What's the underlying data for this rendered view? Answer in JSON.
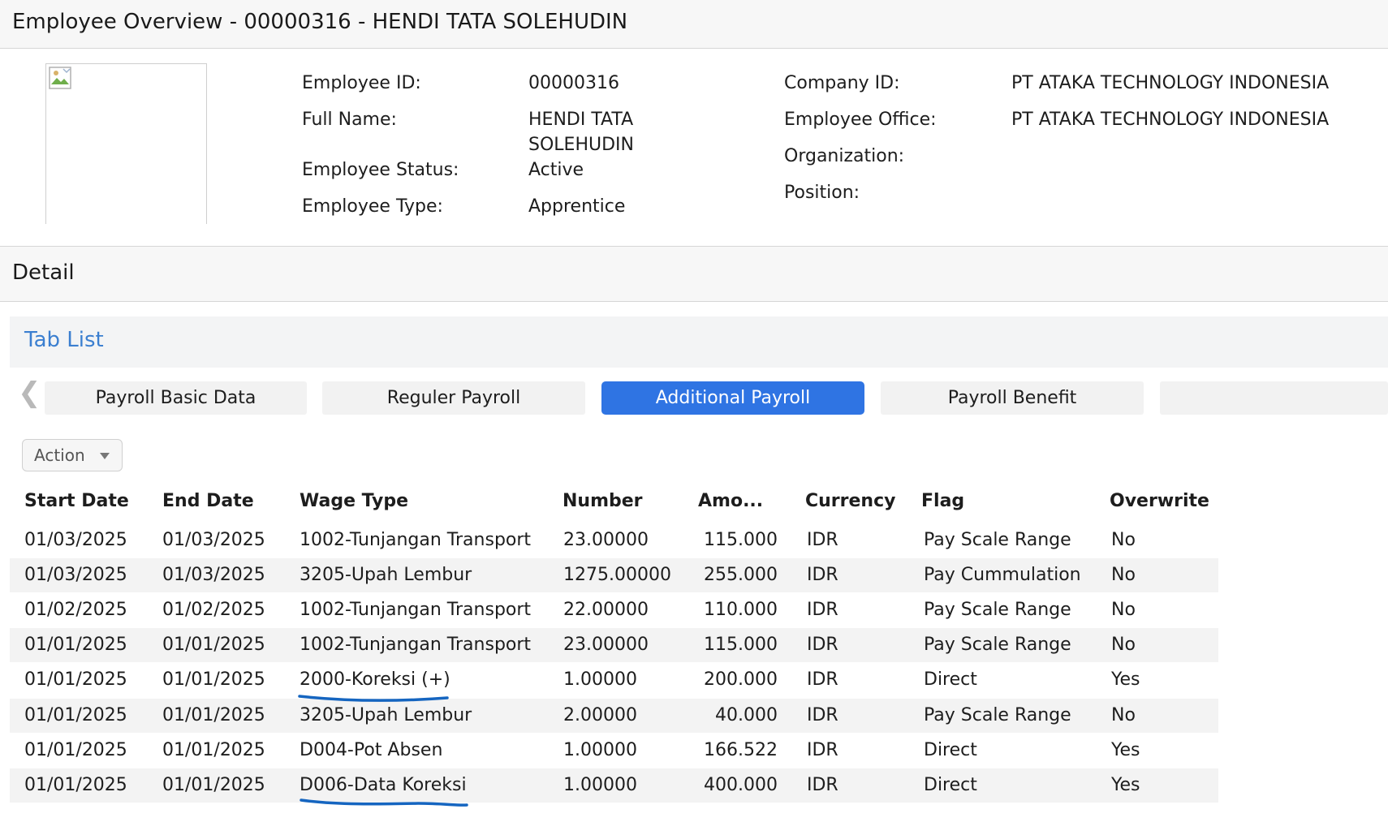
{
  "title": "Employee Overview - 00000316 - HENDI TATA SOLEHUDIN",
  "employee": {
    "labels": {
      "employee_id": "Employee ID:",
      "full_name": "Full Name:",
      "employee_status": "Employee Status:",
      "employee_type": "Employee Type:",
      "company_id": "Company ID:",
      "employee_office": "Employee Office:",
      "organization": "Organization:",
      "position": "Position:"
    },
    "values": {
      "employee_id": "00000316",
      "full_name_line1": "HENDI TATA",
      "full_name_line2": "SOLEHUDIN",
      "employee_status": "Active",
      "employee_type": "Apprentice",
      "company_id": "PT ATAKA TECHNOLOGY INDONESIA",
      "employee_office": "PT ATAKA TECHNOLOGY INDONESIA",
      "organization": "",
      "position": ""
    }
  },
  "detail_title": "Detail",
  "tab_list_title": "Tab List",
  "tabs": [
    {
      "label": "Payroll Basic Data",
      "active": false
    },
    {
      "label": "Reguler Payroll",
      "active": false
    },
    {
      "label": "Additional Payroll",
      "active": true
    },
    {
      "label": "Payroll Benefit",
      "active": false
    },
    {
      "label": "",
      "active": false
    }
  ],
  "action_label": "Action",
  "table": {
    "headers": [
      "Start Date",
      "End Date",
      "Wage Type",
      "Number",
      "Amo...",
      "Currency",
      "Flag",
      "Overwrite"
    ],
    "rows": [
      [
        "01/03/2025",
        "01/03/2025",
        "1002-Tunjangan Transport",
        "23.00000",
        "115.000",
        "IDR",
        "Pay Scale Range",
        "No"
      ],
      [
        "01/03/2025",
        "01/03/2025",
        "3205-Upah Lembur",
        "1275.00000",
        "255.000",
        "IDR",
        "Pay Cummulation",
        "No"
      ],
      [
        "01/02/2025",
        "01/02/2025",
        "1002-Tunjangan Transport",
        "22.00000",
        "110.000",
        "IDR",
        "Pay Scale Range",
        "No"
      ],
      [
        "01/01/2025",
        "01/01/2025",
        "1002-Tunjangan Transport",
        "23.00000",
        "115.000",
        "IDR",
        "Pay Scale Range",
        "No"
      ],
      [
        "01/01/2025",
        "01/01/2025",
        "2000-Koreksi (+)",
        "1.00000",
        "200.000",
        "IDR",
        "Direct",
        "Yes"
      ],
      [
        "01/01/2025",
        "01/01/2025",
        "3205-Upah Lembur",
        "2.00000",
        "40.000",
        "IDR",
        "Pay Scale Range",
        "No"
      ],
      [
        "01/01/2025",
        "01/01/2025",
        "D004-Pot Absen",
        "1.00000",
        "166.522",
        "IDR",
        "Direct",
        "Yes"
      ],
      [
        "01/01/2025",
        "01/01/2025",
        "D006-Data Koreksi",
        "1.00000",
        "400.000",
        "IDR",
        "Direct",
        "Yes"
      ]
    ]
  },
  "colors": {
    "accent": "#2f74e3",
    "link": "#3b7fd0",
    "annotation": "#1565c0"
  }
}
